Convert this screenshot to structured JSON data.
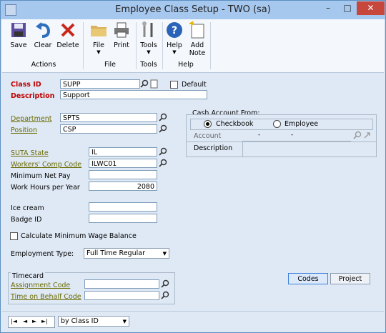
{
  "window": {
    "title": "Employee Class Setup  -  TWO (sa)",
    "minimize_glyph": "–",
    "maximize_glyph": "□",
    "close_glyph": "✕"
  },
  "ribbon": {
    "save": "Save",
    "clear": "Clear",
    "delete": "Delete",
    "actions_group": "Actions",
    "file": "File",
    "print": "Print",
    "file_group": "File",
    "tools": "Tools",
    "tools_group": "Tools",
    "help": "Help",
    "add_note_line1": "Add",
    "add_note_line2": "Note",
    "help_group": "Help",
    "dropdown_glyph": "▼"
  },
  "form": {
    "class_id_label": "Class ID",
    "class_id_value": "SUPP",
    "default_label": "Default",
    "description_label": "Description",
    "description_value": "Support",
    "department_label": "Department",
    "department_value": "SPTS",
    "position_label": "Position",
    "position_value": "CSP",
    "suta_state_label": "SUTA State",
    "suta_state_value": "IL",
    "workers_comp_label": "Workers' Comp Code",
    "workers_comp_value": "ILWC01",
    "min_net_pay_label": "Minimum Net Pay",
    "min_net_pay_value": "",
    "work_hours_label": "Work Hours per Year",
    "work_hours_value": "2080",
    "ice_cream_label": "Ice cream",
    "ice_cream_value": "",
    "badge_id_label": "Badge ID",
    "badge_id_value": "",
    "calc_min_wage_label": "Calculate Minimum Wage Balance",
    "employment_type_label": "Employment Type:",
    "employment_type_value": "Full Time Regular"
  },
  "cash_account": {
    "title": "Cash Account From:",
    "checkbook_label": "Checkbook",
    "employee_label": "Employee",
    "selected": "Checkbook",
    "account_label": "Account",
    "account_seg1": "-",
    "account_seg2": "-",
    "description_label": "Description"
  },
  "timecard": {
    "title": "Timecard",
    "assignment_code_label": "Assignment Code",
    "assignment_code_value": "",
    "time_on_behalf_label": "Time on Behalf Code",
    "time_on_behalf_value": ""
  },
  "buttons": {
    "codes": "Codes",
    "project": "Project"
  },
  "navigation": {
    "first": "|◄",
    "prev": "◄",
    "next": "►",
    "last": "►|",
    "sort_by": "by Class ID"
  },
  "colors": {
    "required_label": "#c00000",
    "link_label": "#6a6a00",
    "title_bar": "#a7c8ee",
    "close_button": "#c7473c"
  }
}
